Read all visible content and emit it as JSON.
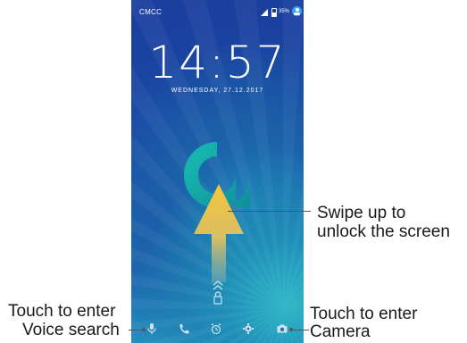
{
  "status_bar": {
    "carrier": "CMCC",
    "battery": "35%"
  },
  "lock_screen": {
    "time": "14:57",
    "date": "WEDNESDAY, 27.12.2017"
  },
  "dock": {
    "icons": [
      "microphone-icon",
      "phone-icon",
      "alarm-icon",
      "settings-icon",
      "camera-icon"
    ]
  },
  "callouts": {
    "swipe_line1": "Swipe up to",
    "swipe_line2": "unlock the screen",
    "voice_line1": "Touch to enter",
    "voice_line2": "Voice search",
    "camera_line1": "Touch to enter",
    "camera_line2": "Camera"
  },
  "colors": {
    "accent_logo": "#16b0a6",
    "arrow_top": "#f4c542",
    "arrow_bottom": "#7fb0b0"
  }
}
